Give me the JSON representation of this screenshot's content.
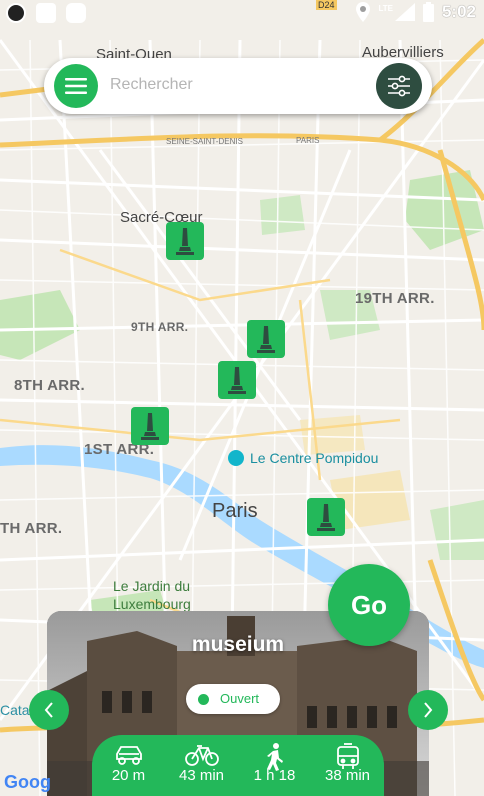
{
  "status_bar": {
    "time": "5:02",
    "network": "LTE"
  },
  "search": {
    "placeholder": "Rechercher"
  },
  "map_labels": {
    "saint_ouen": "Saint-Ouen",
    "aubervilliers": "Aubervilliers",
    "seine_saint_denis": "SEINE-SAINT-DENIS",
    "paris_small": "PARIS",
    "sacre_coeur": "Sacré-Cœur",
    "arr19": "19TH ARR.",
    "arr9": "9TH ARR.",
    "arr8": "8TH ARR.",
    "arr1": "1ST ARR.",
    "arr7": "TH ARR.",
    "pompidou": "Le Centre Pompidou",
    "paris": "Paris",
    "jardin_1": "Le Jardin du",
    "jardin_2": "Luxembourg",
    "cata": "Cata",
    "road_d24": "D24"
  },
  "go_button": {
    "label": "Go"
  },
  "card": {
    "title": "museium",
    "status": "Ouvert",
    "transport": [
      {
        "icon": "car-icon",
        "value": "20 m"
      },
      {
        "icon": "bike-icon",
        "value": "43 min"
      },
      {
        "icon": "walk-icon",
        "value": "1 h 18"
      },
      {
        "icon": "bus-icon",
        "value": "38 min"
      }
    ]
  },
  "google_logo": "Goog",
  "colors": {
    "accent": "#23b85a",
    "filter": "#2e4d40"
  }
}
